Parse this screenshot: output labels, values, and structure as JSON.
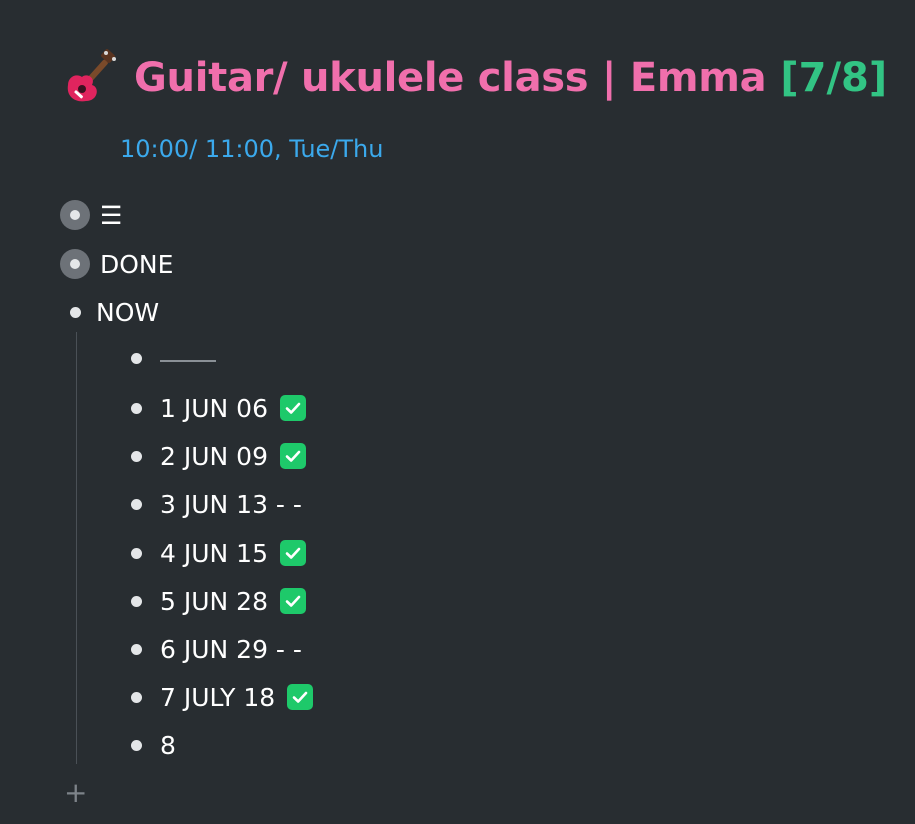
{
  "title": {
    "text": "Guitar/ ukulele class | Emma",
    "count": "[7/8]",
    "icon": "guitar-icon"
  },
  "subtitle": "10:00/ 11:00, Tue/Thu",
  "top_items": [
    {
      "label": "☰"
    },
    {
      "label": "DONE"
    },
    {
      "label": "NOW"
    }
  ],
  "children": [
    {
      "label": "",
      "done": false,
      "separator": true
    },
    {
      "label": "1 JUN 06",
      "done": true
    },
    {
      "label": "2 JUN 09",
      "done": true
    },
    {
      "label": "3 JUN 13 - -",
      "done": false
    },
    {
      "label": "4 JUN 15",
      "done": true
    },
    {
      "label": "5 JUN 28",
      "done": true
    },
    {
      "label": "6 JUN 29 - -",
      "done": false
    },
    {
      "label": "7 JULY 18",
      "done": true
    },
    {
      "label": "8",
      "done": false
    }
  ],
  "add_label": "+",
  "colors": {
    "background": "#282d31",
    "title": "#f06fac",
    "count": "#32c484",
    "subtitle": "#3ba9ec",
    "check": "#1ec96a"
  }
}
